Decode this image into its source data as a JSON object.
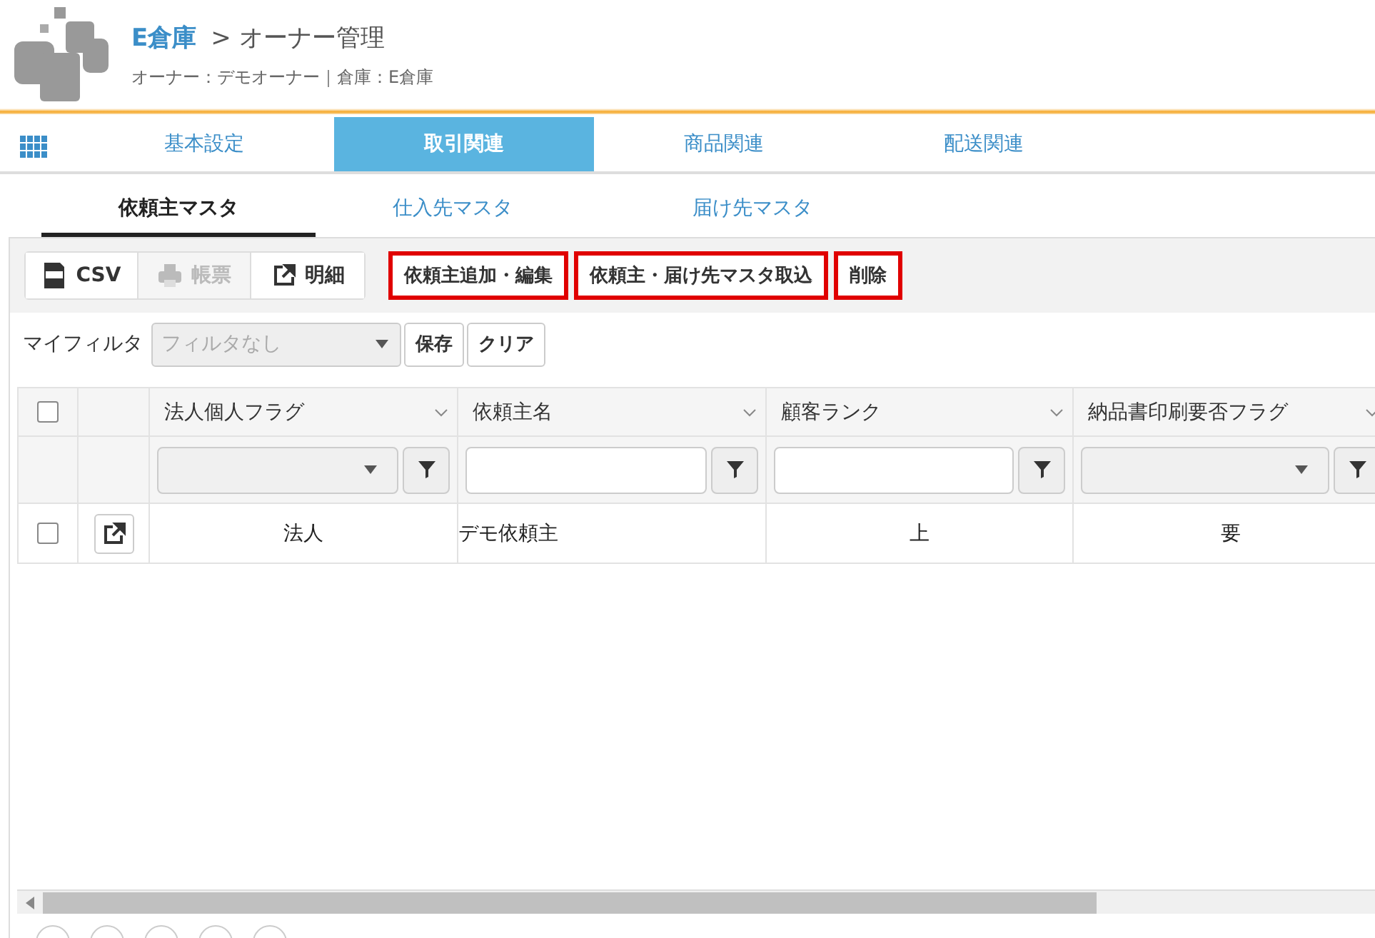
{
  "header": {
    "title_link": "E倉庫",
    "title": "> オーナー管理",
    "subtitle": "オーナー：デモオーナー｜倉庫：E倉庫"
  },
  "main_tabs": [
    {
      "label": "基本設定",
      "selected": false
    },
    {
      "label": "取引関連",
      "selected": true
    },
    {
      "label": "商品関連",
      "selected": false
    },
    {
      "label": "配送関連",
      "selected": false
    }
  ],
  "sub_tabs": [
    {
      "label": "依頼主マスタ",
      "selected": true
    },
    {
      "label": "仕入先マスタ",
      "selected": false
    },
    {
      "label": "届け先マスタ",
      "selected": false
    }
  ],
  "toolbar": [
    {
      "kind": "csv",
      "label": "CSV",
      "disabled": false
    },
    {
      "kind": "print",
      "label": "帳票",
      "disabled": true
    },
    {
      "kind": "detail",
      "label": "明細",
      "disabled": false
    }
  ],
  "actions": [
    {
      "label": "依頼主追加・編集",
      "highlighted": true
    },
    {
      "label": "依頼主・届け先マスタ取込",
      "highlighted": true
    },
    {
      "label": "削除",
      "highlighted": true
    }
  ],
  "my_filter": {
    "label": "マイフィルタ",
    "placeholder": "フィルタなし",
    "disabled": true,
    "buttons": [
      "保存",
      "クリア"
    ]
  },
  "table": {
    "header_checked": false,
    "columns": [
      {
        "label": "法人個人フラグ",
        "kind": "select"
      },
      {
        "label": "依頼主名",
        "kind": "text"
      },
      {
        "label": "顧客ランク",
        "kind": "text"
      },
      {
        "label": "納品書印刷要否フラグ",
        "kind": "select"
      }
    ],
    "rows": [
      {
        "checked": false,
        "cells": [
          "法人",
          "デモ依頼主",
          "上",
          "要"
        ]
      }
    ]
  }
}
